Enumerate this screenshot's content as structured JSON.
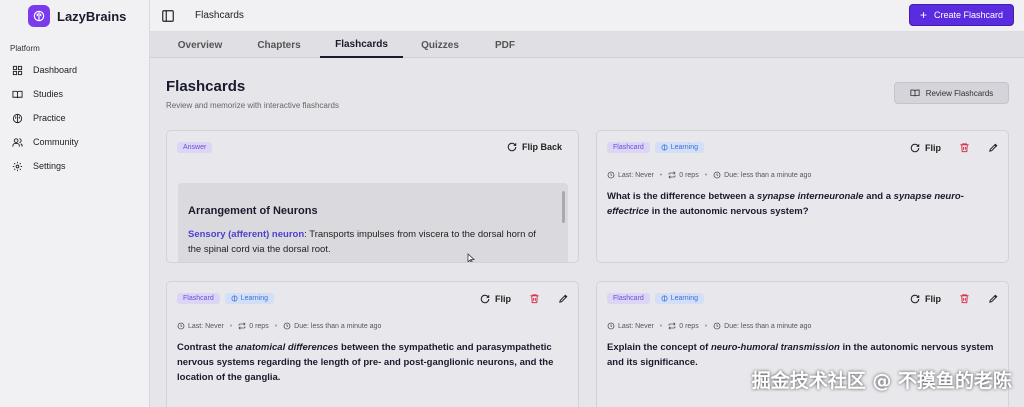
{
  "app": {
    "name": "LazyBrains",
    "brand_color": "#7c3aed"
  },
  "sidebar": {
    "section_label": "Platform",
    "items": [
      {
        "label": "Dashboard",
        "icon": "dashboard-icon"
      },
      {
        "label": "Studies",
        "icon": "book-icon"
      },
      {
        "label": "Practice",
        "icon": "brain-icon"
      },
      {
        "label": "Community",
        "icon": "users-icon"
      },
      {
        "label": "Settings",
        "icon": "gear-icon"
      }
    ]
  },
  "header": {
    "breadcrumb": "Flashcards",
    "create_button": "Create Flashcard",
    "accent_color": "#5b2be0"
  },
  "tabs": [
    {
      "label": "Overview",
      "active": false
    },
    {
      "label": "Chapters",
      "active": false
    },
    {
      "label": "Flashcards",
      "active": true
    },
    {
      "label": "Quizzes",
      "active": false
    },
    {
      "label": "PDF",
      "active": false
    }
  ],
  "page": {
    "title": "Flashcards",
    "subtitle": "Review and memorize with interactive flashcards",
    "review_button": "Review Flashcards"
  },
  "cards": [
    {
      "badge": "Answer",
      "flip_label": "Flip Back",
      "answer_title": "Arrangement of Neurons",
      "answer_term": "Sensory (afferent) neuron",
      "answer_text": ": Transports impulses from viscera to the dorsal horn of the spinal cord via the dorsal root."
    },
    {
      "badge": "Flashcard",
      "status": "Learning",
      "flip_label": "Flip",
      "last": "Last: Never",
      "reps": "0 reps",
      "due": "Due: less than a minute ago",
      "question_parts": [
        "What is the difference between a ",
        "synapse interneuronale",
        " and a ",
        "synapse neuro-effectrice",
        " in the autonomic nervous system?"
      ]
    },
    {
      "badge": "Flashcard",
      "status": "Learning",
      "flip_label": "Flip",
      "last": "Last: Never",
      "reps": "0 reps",
      "due": "Due: less than a minute ago",
      "question_parts": [
        "Contrast the ",
        "anatomical differences",
        " between the sympathetic and parasympathetic nervous systems regarding the length of pre- and post-ganglionic neurons, and the location of the ganglia.",
        "",
        ""
      ]
    },
    {
      "badge": "Flashcard",
      "status": "Learning",
      "flip_label": "Flip",
      "last": "Last: Never",
      "reps": "0 reps",
      "due": "Due: less than a minute ago",
      "question_parts": [
        "Explain the concept of ",
        "neuro-humoral transmission",
        " in the autonomic nervous system and its significance.",
        "",
        ""
      ]
    }
  ],
  "watermark": "掘金技术社区 @ 不摸鱼的老陈"
}
